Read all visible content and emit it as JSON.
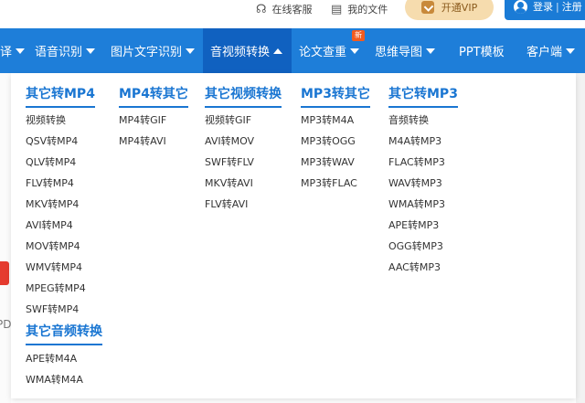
{
  "topbar": {
    "service_label": "在线客服",
    "files_label": "我的文件",
    "vip_label": "开通VIP",
    "login_label": "登录",
    "register_label": "注册"
  },
  "nav": {
    "items": [
      {
        "label": "译",
        "has_caret": true
      },
      {
        "label": "语音识别",
        "has_caret": true
      },
      {
        "label": "图片文字识别",
        "has_caret": true
      },
      {
        "label": "音视频转换",
        "has_caret": true,
        "active": true
      },
      {
        "label": "论文查重",
        "has_caret": true,
        "badge": "新"
      },
      {
        "label": "思维导图",
        "has_caret": true
      },
      {
        "label": "PPT模板",
        "has_caret": false
      },
      {
        "label": "客户端",
        "has_caret": true
      }
    ]
  },
  "left": {
    "partial_text": "PD"
  },
  "menu": {
    "columns": [
      {
        "title": "其它转MP4",
        "links": [
          "视频转换",
          "QSV转MP4",
          "QLV转MP4",
          "FLV转MP4",
          "MKV转MP4",
          "AVI转MP4",
          "MOV转MP4",
          "WMV转MP4",
          "MPEG转MP4",
          "SWF转MP4"
        ]
      },
      {
        "title": "MP4转其它",
        "links": [
          "MP4转GIF",
          "MP4转AVI"
        ]
      },
      {
        "title": "其它视频转换",
        "links": [
          "视频转GIF",
          "AVI转MOV",
          "SWF转FLV",
          "MKV转AVI",
          "FLV转AVI"
        ]
      },
      {
        "title": "MP3转其它",
        "links": [
          "MP3转M4A",
          "MP3转OGG",
          "MP3转WAV",
          "MP3转FLAC"
        ]
      },
      {
        "title": "其它转MP3",
        "links": [
          "音频转换",
          "M4A转MP3",
          "FLAC转MP3",
          "WAV转MP3",
          "WMA转MP3",
          "APE转MP3",
          "OGG转MP3",
          "AAC转MP3"
        ]
      }
    ],
    "audio_section": {
      "title": "其它音频转换",
      "links": [
        "APE转M4A",
        "WMA转M4A"
      ]
    }
  },
  "colors": {
    "nav_bg": "#1e7ed9",
    "nav_active_bg": "#1061c0",
    "title_blue": "#1a76d2",
    "vip_bg": "#f6dcae",
    "badge": "#f25b1f"
  }
}
